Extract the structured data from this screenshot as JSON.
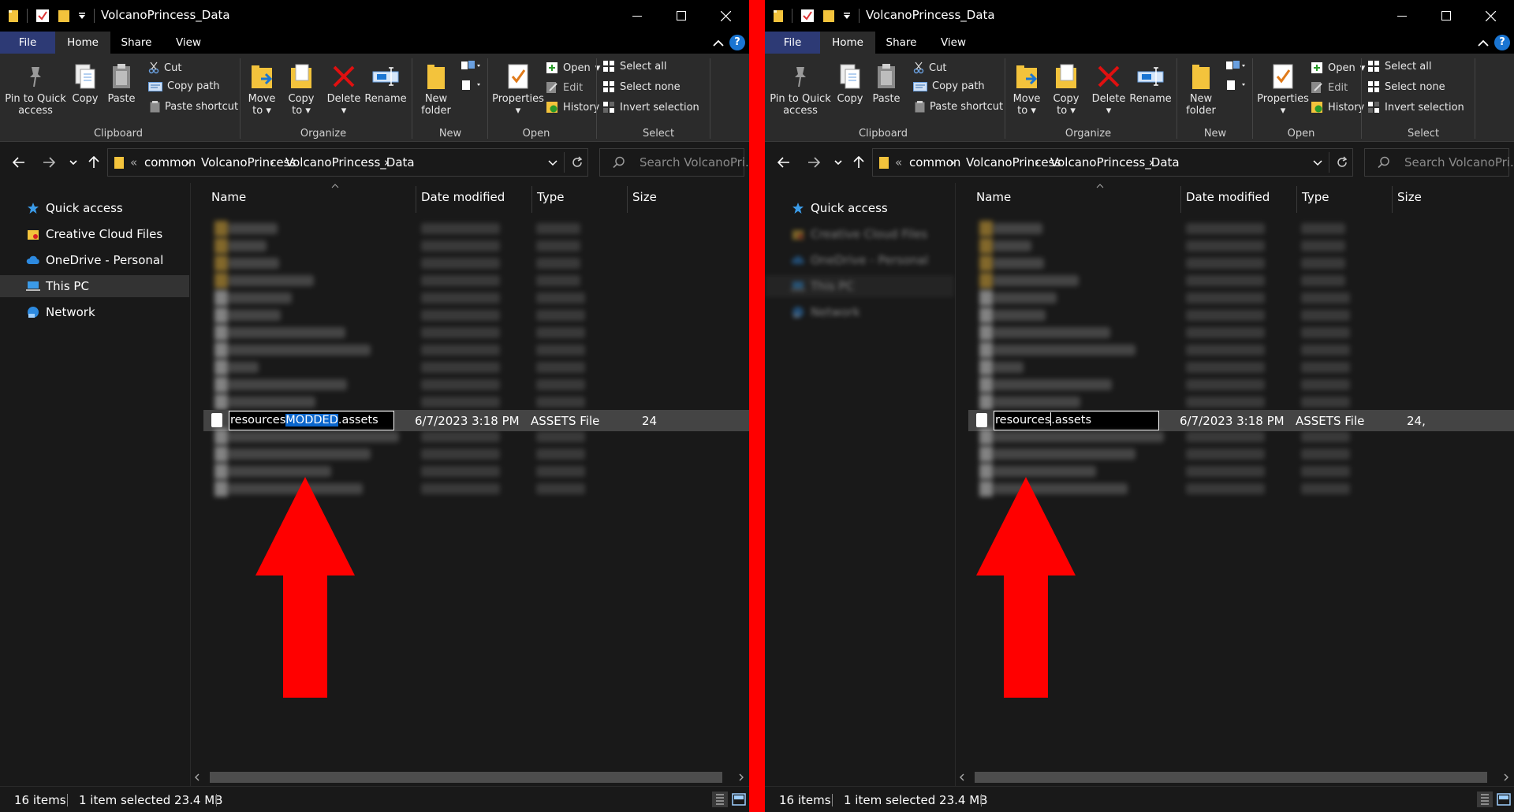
{
  "windows": [
    {
      "title": "VolcanoPrincess_Data",
      "tabs": [
        "File",
        "Home",
        "Share",
        "View"
      ],
      "ribbon": {
        "clipboard": {
          "pin_line1": "Pin to Quick",
          "pin_line2": "access",
          "copy": "Copy",
          "paste": "Paste",
          "cut": "Cut",
          "copy_path": "Copy path",
          "paste_shortcut": "Paste shortcut",
          "group": "Clipboard"
        },
        "organize": {
          "move_line1": "Move",
          "move_line2": "to",
          "copy_line1": "Copy",
          "copy_line2": "to",
          "delete": "Delete",
          "rename": "Rename",
          "group": "Organize"
        },
        "new": {
          "folder_line1": "New",
          "folder_line2": "folder",
          "group": "New"
        },
        "open": {
          "properties": "Properties",
          "open": "Open",
          "edit": "Edit",
          "history": "History",
          "group": "Open"
        },
        "select": {
          "select_all": "Select all",
          "select_none": "Select none",
          "invert": "Invert selection",
          "group": "Select"
        }
      },
      "breadcrumb": {
        "prefix": "«",
        "items": [
          "common",
          "VolcanoPrincess",
          "VolcanoPrincess_Data"
        ]
      },
      "search_placeholder": "Search VolcanoPri...",
      "nav": {
        "quick_access": "Quick access",
        "creative_cloud": "Creative Cloud Files",
        "onedrive": "OneDrive - Personal",
        "this_pc": "This PC",
        "network": "Network"
      },
      "columns": {
        "name": "Name",
        "date": "Date modified",
        "type": "Type",
        "size": "Size"
      },
      "selected_file": {
        "name_part1": "resources",
        "name_part2": "MODDED",
        "name_part3": ".assets",
        "date": "6/7/2023 3:18 PM",
        "type": "ASSETS File",
        "size": "24"
      },
      "status": {
        "items": "16 items",
        "selected": "1 item selected  23.4 MB"
      }
    },
    {
      "title": "VolcanoPrincess_Data",
      "tabs": [
        "File",
        "Home",
        "Share",
        "View"
      ],
      "ribbon": {
        "clipboard": {
          "pin_line1": "Pin to Quick",
          "pin_line2": "access",
          "copy": "Copy",
          "paste": "Paste",
          "cut": "Cut",
          "copy_path": "Copy path",
          "paste_shortcut": "Paste shortcut",
          "group": "Clipboard"
        },
        "organize": {
          "move_line1": "Move",
          "move_line2": "to",
          "copy_line1": "Copy",
          "copy_line2": "to",
          "delete": "Delete",
          "rename": "Rename",
          "group": "Organize"
        },
        "new": {
          "folder_line1": "New",
          "folder_line2": "folder",
          "group": "New"
        },
        "open": {
          "properties": "Properties",
          "open": "Open",
          "edit": "Edit",
          "history": "History",
          "group": "Open"
        },
        "select": {
          "select_all": "Select all",
          "select_none": "Select none",
          "invert": "Invert selection",
          "group": "Select"
        }
      },
      "breadcrumb": {
        "prefix": "«",
        "items": [
          "common",
          "VolcanoPrincess",
          "VolcanoPrincess_Data"
        ]
      },
      "search_placeholder": "Search VolcanoPri...",
      "nav": {
        "quick_access": "Quick access",
        "creative_cloud": "Creative Cloud Files",
        "onedrive": "OneDrive - Personal",
        "this_pc": "This PC",
        "network": "Network"
      },
      "columns": {
        "name": "Name",
        "date": "Date modified",
        "type": "Type",
        "size": "Size"
      },
      "selected_file": {
        "name_part1": "resources",
        "name_part2": "",
        "name_part3": ".assets",
        "date": "6/7/2023 3:18 PM",
        "type": "ASSETS File",
        "size": "24,"
      },
      "status": {
        "items": "16 items",
        "selected": "1 item selected  23.4 MB"
      }
    }
  ],
  "colors": {
    "divider": "#ff0000",
    "arrow": "#ff0000",
    "selection_highlight": "#0b66cc",
    "file_tab": "#2d3a75"
  }
}
